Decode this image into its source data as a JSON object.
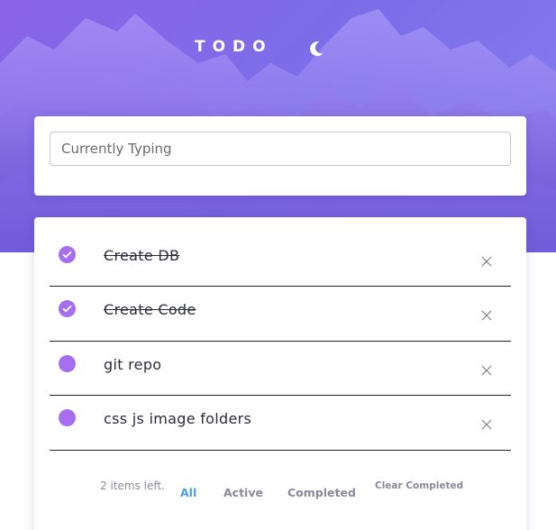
{
  "app": {
    "title": "TODO",
    "theme_icon": "moon-icon",
    "accent_color": "#a66ff0",
    "active_filter_color": "#4a9ff0"
  },
  "input": {
    "value": "",
    "placeholder": "Currently Typing"
  },
  "todos": [
    {
      "text": "Create DB",
      "completed": true
    },
    {
      "text": "Create Code",
      "completed": true
    },
    {
      "text": "git repo",
      "completed": false
    },
    {
      "text": "css js image folders",
      "completed": false
    }
  ],
  "footer": {
    "items_left": "2 items left.",
    "filters": [
      "All",
      "Active",
      "Completed"
    ],
    "active_filter": "All",
    "clear_label": "Clear Completed"
  }
}
